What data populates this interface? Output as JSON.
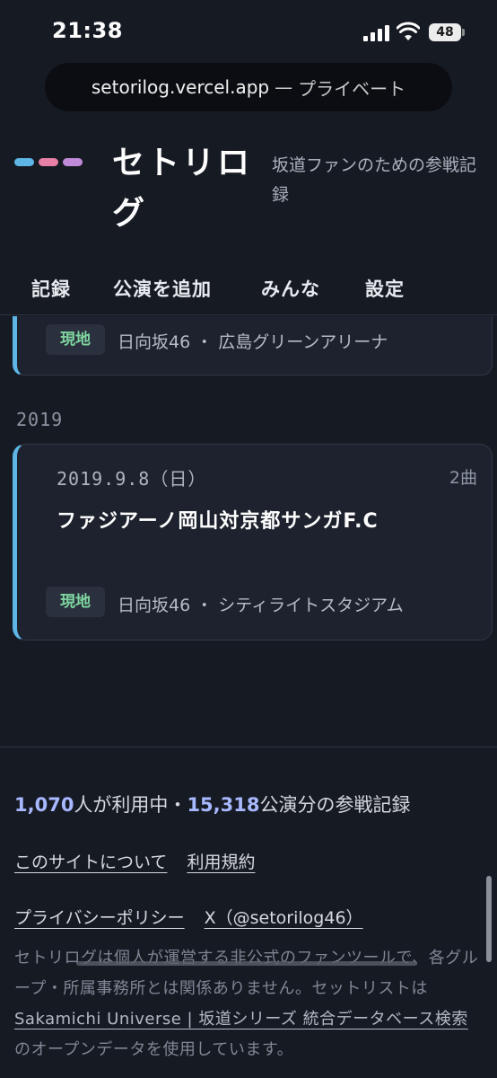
{
  "status": {
    "time": "21:38",
    "battery": "48"
  },
  "browser": {
    "url": "setorilog.vercel.app",
    "separator": "—",
    "mode": "プライベート"
  },
  "site": {
    "title": "セトリログ",
    "tagline": "坂道ファンのための参戦記録",
    "logo_colors": [
      "#5db6e6",
      "#e87fa6",
      "#c08ad8"
    ]
  },
  "nav": {
    "items": [
      "記録",
      "公演を追加",
      "みんな",
      "設定"
    ]
  },
  "entries": [
    {
      "badge": "現地",
      "group": "日向坂46",
      "separator": "・",
      "venue": "広島グリーンアリーナ"
    }
  ],
  "year_group": {
    "year": "2019",
    "entries": [
      {
        "date": "2019.9.8（日）",
        "songs": "2曲",
        "title": "ファジアーノ岡山対京都サンガF.C",
        "badge": "現地",
        "group": "日向坂46",
        "separator": "・",
        "venue": "シティライトスタジアム"
      }
    ]
  },
  "footer": {
    "stats": {
      "users": "1,070",
      "users_suffix": "人が利用中",
      "sep": "・",
      "shows": "15,318",
      "shows_suffix": "公演分の参戦記録"
    },
    "links_row1": [
      "このサイトについて",
      "利用規約"
    ],
    "links_row2": [
      "プライバシーポリシー",
      "X（@setorilog46）"
    ],
    "disclaimer_pre": "セトリログは個人が運営する非公式のファンツールで、各グループ・所属事務所とは関係ありません。セットリストは ",
    "disclaimer_link": "Sakamichi Universe | 坂道シリーズ 統合データベース検索",
    "disclaimer_post": " のオープンデータを使用しています。"
  },
  "colors": {
    "accent": "#5db6e6",
    "badge_text": "#7fd6a0",
    "stat_number": "#a7b8ff"
  }
}
